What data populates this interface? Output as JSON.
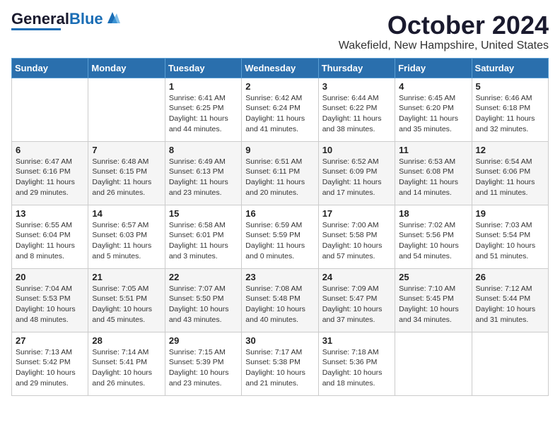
{
  "header": {
    "logo_general": "General",
    "logo_blue": "Blue",
    "month_title": "October 2024",
    "location": "Wakefield, New Hampshire, United States"
  },
  "weekdays": [
    "Sunday",
    "Monday",
    "Tuesday",
    "Wednesday",
    "Thursday",
    "Friday",
    "Saturday"
  ],
  "weeks": [
    [
      {
        "day": "",
        "sunrise": "",
        "sunset": "",
        "daylight": ""
      },
      {
        "day": "",
        "sunrise": "",
        "sunset": "",
        "daylight": ""
      },
      {
        "day": "1",
        "sunrise": "Sunrise: 6:41 AM",
        "sunset": "Sunset: 6:25 PM",
        "daylight": "Daylight: 11 hours and 44 minutes."
      },
      {
        "day": "2",
        "sunrise": "Sunrise: 6:42 AM",
        "sunset": "Sunset: 6:24 PM",
        "daylight": "Daylight: 11 hours and 41 minutes."
      },
      {
        "day": "3",
        "sunrise": "Sunrise: 6:44 AM",
        "sunset": "Sunset: 6:22 PM",
        "daylight": "Daylight: 11 hours and 38 minutes."
      },
      {
        "day": "4",
        "sunrise": "Sunrise: 6:45 AM",
        "sunset": "Sunset: 6:20 PM",
        "daylight": "Daylight: 11 hours and 35 minutes."
      },
      {
        "day": "5",
        "sunrise": "Sunrise: 6:46 AM",
        "sunset": "Sunset: 6:18 PM",
        "daylight": "Daylight: 11 hours and 32 minutes."
      }
    ],
    [
      {
        "day": "6",
        "sunrise": "Sunrise: 6:47 AM",
        "sunset": "Sunset: 6:16 PM",
        "daylight": "Daylight: 11 hours and 29 minutes."
      },
      {
        "day": "7",
        "sunrise": "Sunrise: 6:48 AM",
        "sunset": "Sunset: 6:15 PM",
        "daylight": "Daylight: 11 hours and 26 minutes."
      },
      {
        "day": "8",
        "sunrise": "Sunrise: 6:49 AM",
        "sunset": "Sunset: 6:13 PM",
        "daylight": "Daylight: 11 hours and 23 minutes."
      },
      {
        "day": "9",
        "sunrise": "Sunrise: 6:51 AM",
        "sunset": "Sunset: 6:11 PM",
        "daylight": "Daylight: 11 hours and 20 minutes."
      },
      {
        "day": "10",
        "sunrise": "Sunrise: 6:52 AM",
        "sunset": "Sunset: 6:09 PM",
        "daylight": "Daylight: 11 hours and 17 minutes."
      },
      {
        "day": "11",
        "sunrise": "Sunrise: 6:53 AM",
        "sunset": "Sunset: 6:08 PM",
        "daylight": "Daylight: 11 hours and 14 minutes."
      },
      {
        "day": "12",
        "sunrise": "Sunrise: 6:54 AM",
        "sunset": "Sunset: 6:06 PM",
        "daylight": "Daylight: 11 hours and 11 minutes."
      }
    ],
    [
      {
        "day": "13",
        "sunrise": "Sunrise: 6:55 AM",
        "sunset": "Sunset: 6:04 PM",
        "daylight": "Daylight: 11 hours and 8 minutes."
      },
      {
        "day": "14",
        "sunrise": "Sunrise: 6:57 AM",
        "sunset": "Sunset: 6:03 PM",
        "daylight": "Daylight: 11 hours and 5 minutes."
      },
      {
        "day": "15",
        "sunrise": "Sunrise: 6:58 AM",
        "sunset": "Sunset: 6:01 PM",
        "daylight": "Daylight: 11 hours and 3 minutes."
      },
      {
        "day": "16",
        "sunrise": "Sunrise: 6:59 AM",
        "sunset": "Sunset: 5:59 PM",
        "daylight": "Daylight: 11 hours and 0 minutes."
      },
      {
        "day": "17",
        "sunrise": "Sunrise: 7:00 AM",
        "sunset": "Sunset: 5:58 PM",
        "daylight": "Daylight: 10 hours and 57 minutes."
      },
      {
        "day": "18",
        "sunrise": "Sunrise: 7:02 AM",
        "sunset": "Sunset: 5:56 PM",
        "daylight": "Daylight: 10 hours and 54 minutes."
      },
      {
        "day": "19",
        "sunrise": "Sunrise: 7:03 AM",
        "sunset": "Sunset: 5:54 PM",
        "daylight": "Daylight: 10 hours and 51 minutes."
      }
    ],
    [
      {
        "day": "20",
        "sunrise": "Sunrise: 7:04 AM",
        "sunset": "Sunset: 5:53 PM",
        "daylight": "Daylight: 10 hours and 48 minutes."
      },
      {
        "day": "21",
        "sunrise": "Sunrise: 7:05 AM",
        "sunset": "Sunset: 5:51 PM",
        "daylight": "Daylight: 10 hours and 45 minutes."
      },
      {
        "day": "22",
        "sunrise": "Sunrise: 7:07 AM",
        "sunset": "Sunset: 5:50 PM",
        "daylight": "Daylight: 10 hours and 43 minutes."
      },
      {
        "day": "23",
        "sunrise": "Sunrise: 7:08 AM",
        "sunset": "Sunset: 5:48 PM",
        "daylight": "Daylight: 10 hours and 40 minutes."
      },
      {
        "day": "24",
        "sunrise": "Sunrise: 7:09 AM",
        "sunset": "Sunset: 5:47 PM",
        "daylight": "Daylight: 10 hours and 37 minutes."
      },
      {
        "day": "25",
        "sunrise": "Sunrise: 7:10 AM",
        "sunset": "Sunset: 5:45 PM",
        "daylight": "Daylight: 10 hours and 34 minutes."
      },
      {
        "day": "26",
        "sunrise": "Sunrise: 7:12 AM",
        "sunset": "Sunset: 5:44 PM",
        "daylight": "Daylight: 10 hours and 31 minutes."
      }
    ],
    [
      {
        "day": "27",
        "sunrise": "Sunrise: 7:13 AM",
        "sunset": "Sunset: 5:42 PM",
        "daylight": "Daylight: 10 hours and 29 minutes."
      },
      {
        "day": "28",
        "sunrise": "Sunrise: 7:14 AM",
        "sunset": "Sunset: 5:41 PM",
        "daylight": "Daylight: 10 hours and 26 minutes."
      },
      {
        "day": "29",
        "sunrise": "Sunrise: 7:15 AM",
        "sunset": "Sunset: 5:39 PM",
        "daylight": "Daylight: 10 hours and 23 minutes."
      },
      {
        "day": "30",
        "sunrise": "Sunrise: 7:17 AM",
        "sunset": "Sunset: 5:38 PM",
        "daylight": "Daylight: 10 hours and 21 minutes."
      },
      {
        "day": "31",
        "sunrise": "Sunrise: 7:18 AM",
        "sunset": "Sunset: 5:36 PM",
        "daylight": "Daylight: 10 hours and 18 minutes."
      },
      {
        "day": "",
        "sunrise": "",
        "sunset": "",
        "daylight": ""
      },
      {
        "day": "",
        "sunrise": "",
        "sunset": "",
        "daylight": ""
      }
    ]
  ]
}
